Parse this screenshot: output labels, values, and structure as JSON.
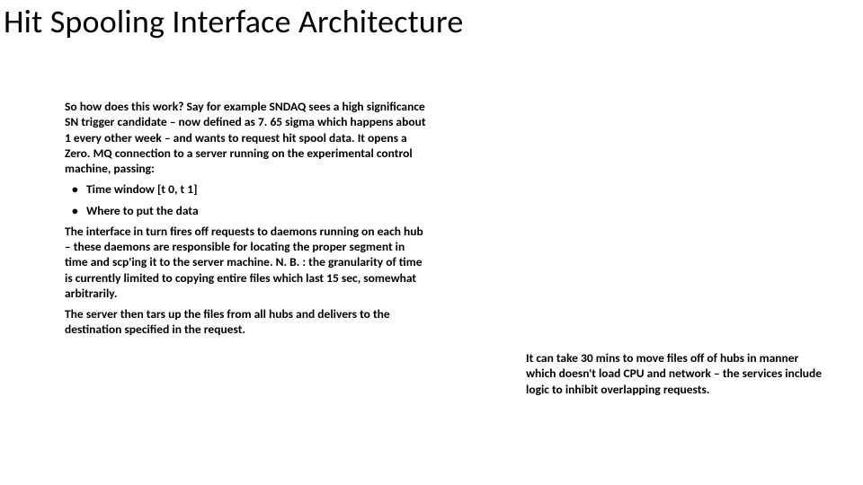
{
  "title": "Hit Spooling Interface Architecture",
  "left": {
    "intro": "So how does this work?  Say for example SNDAQ sees a high significance SN trigger candidate – now defined as 7. 65 sigma which happens about 1 every other week – and wants to request hit spool data.  It opens a Zero. MQ connection to a server running on the experimental control machine, passing:",
    "bullet1": "Time window [t 0, t 1]",
    "bullet2": "Where to put the data",
    "para2": "The interface in turn fires off requests to daemons running on each hub – these daemons are responsible for locating the proper segment in time and scp'ing it to the server machine.  N. B. : the granularity of time is currently limited to copying entire files which last 15 sec, somewhat arbitrarily.",
    "para3": "The server then tars up the files from all hubs and delivers to the destination specified in the request."
  },
  "right": {
    "note": "It can take 30 mins to move files off of hubs in manner which doesn't load CPU and network – the services include logic to inhibit overlapping requests."
  }
}
